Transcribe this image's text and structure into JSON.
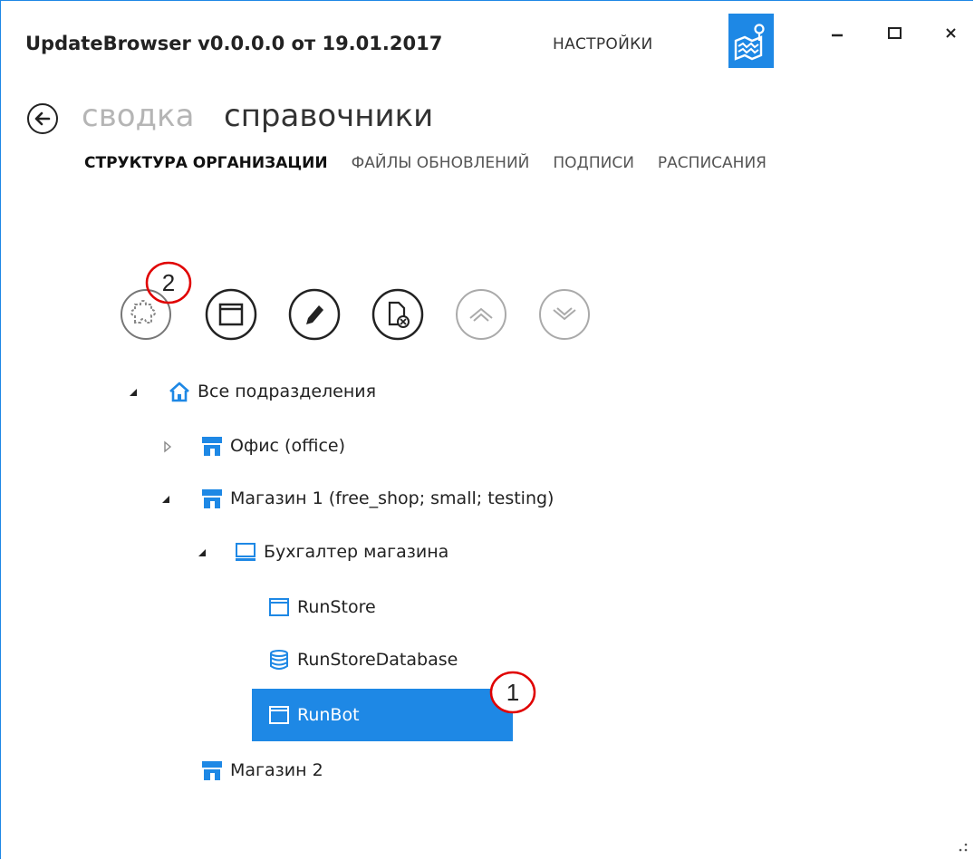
{
  "window": {
    "title": "UpdateBrowser v0.0.0.0 от 19.01.2017",
    "settings_label": "НАСТРОЙКИ",
    "map_icon": "map-icon",
    "accent_color": "#1e88e5"
  },
  "breadcrumb": {
    "previous": "сводка",
    "current": "справочники"
  },
  "tabs": [
    {
      "label": "СТРУКТУРА ОРГАНИЗАЦИИ",
      "active": true
    },
    {
      "label": "ФАЙЛЫ ОБНОВЛЕНИЙ",
      "active": false
    },
    {
      "label": "ПОДПИСИ",
      "active": false
    },
    {
      "label": "РАСПИСАНИЯ",
      "active": false
    }
  ],
  "toolbar": {
    "buttons": [
      {
        "name": "puzzle-icon"
      },
      {
        "name": "window-icon"
      },
      {
        "name": "pencil-icon"
      },
      {
        "name": "delete-file-icon"
      },
      {
        "name": "move-up-icon"
      },
      {
        "name": "move-down-icon"
      }
    ]
  },
  "tree": {
    "root": "Все подразделения",
    "office": "Офис (office)",
    "shop1": "Магазин 1 (free_shop; small; testing)",
    "accountant": "Бухгалтер магазина",
    "runstore": "RunStore",
    "runstore_db": "RunStoreDatabase",
    "runbot": "RunBot",
    "shop2": "Магазин 2",
    "selected": "RunBot"
  },
  "callouts": {
    "one": "1",
    "two": "2"
  }
}
